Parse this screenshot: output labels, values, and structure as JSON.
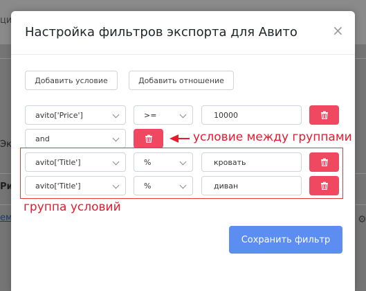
{
  "background": {
    "top_text": "ция",
    "frag1": "Экс",
    "frag2": "Ри",
    "frag3": "емо"
  },
  "modal": {
    "title": "Настройка фильтров экспорта для Авито",
    "add_condition_label": "Добавить условие",
    "add_relation_label": "Добавить отношение",
    "save_label": "Сохранить фильтр"
  },
  "rows": [
    {
      "field": "avito['Price']",
      "operator": ">=",
      "value": "10000"
    },
    {
      "relation": "and"
    },
    {
      "field": "avito['Title']",
      "operator": "%",
      "value": "кровать"
    },
    {
      "field": "avito['Title']",
      "operator": "%",
      "value": "диван"
    }
  ],
  "annotations": {
    "between_groups": "условие между группами",
    "group_label": "группа условий"
  },
  "colors": {
    "delete_button": "#f04860",
    "primary": "#5b8ef0",
    "annotation": "#e8192c"
  },
  "icons": {
    "delete": "trash-icon",
    "close": "close-icon",
    "select": "chevron-down-icon",
    "settings": "gear-icon"
  }
}
